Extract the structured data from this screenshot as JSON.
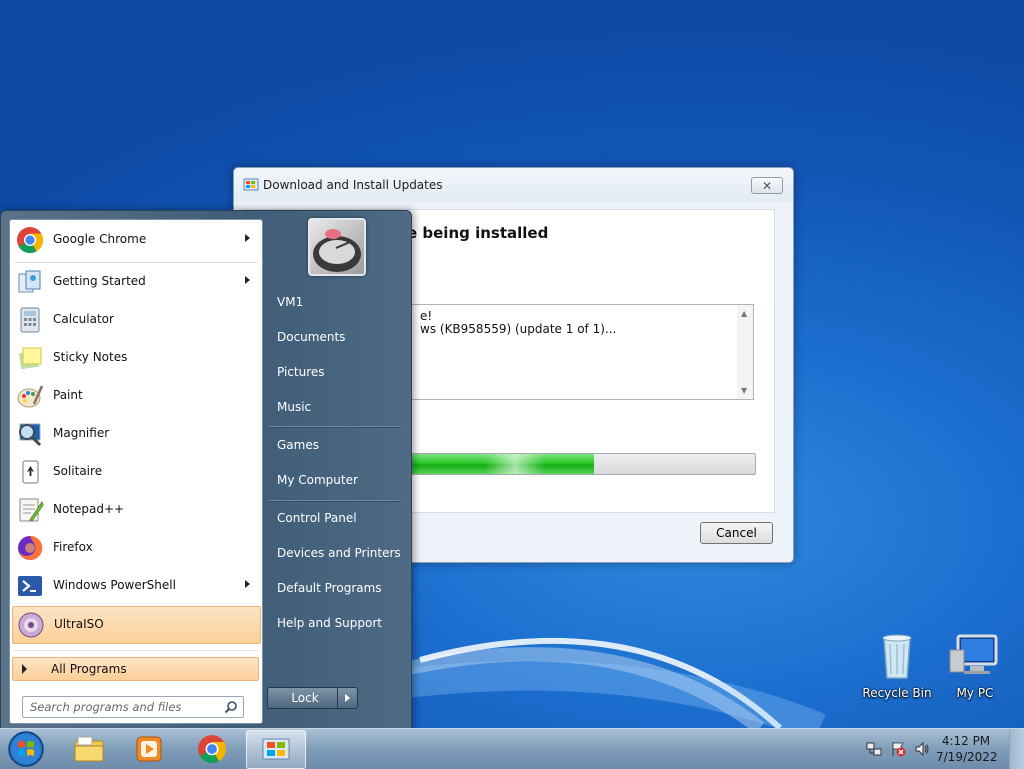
{
  "dialog": {
    "title": "Download and Install Updates",
    "heading": "e being installed",
    "log_line1": "e!",
    "log_line2": "ws (KB958559) (update 1 of 1)...",
    "progress": 0.53,
    "cancel_label": "Cancel"
  },
  "start_menu": {
    "pinned": [
      {
        "label": "Google Chrome",
        "icon": "chrome-icon",
        "has_submenu": true
      },
      {
        "label": "Getting Started",
        "icon": "getting-started-icon",
        "has_submenu": true
      },
      {
        "label": "Calculator",
        "icon": "calculator-icon",
        "has_submenu": false
      },
      {
        "label": "Sticky Notes",
        "icon": "sticky-notes-icon",
        "has_submenu": false
      },
      {
        "label": "Paint",
        "icon": "paint-icon",
        "has_submenu": false
      },
      {
        "label": "Magnifier",
        "icon": "magnifier-icon",
        "has_submenu": false
      },
      {
        "label": "Solitaire",
        "icon": "solitaire-icon",
        "has_submenu": false
      },
      {
        "label": "Notepad++",
        "icon": "notepadpp-icon",
        "has_submenu": false
      },
      {
        "label": "Firefox",
        "icon": "firefox-icon",
        "has_submenu": false
      },
      {
        "label": "Windows PowerShell",
        "icon": "powershell-icon",
        "has_submenu": true
      },
      {
        "label": "UltraISO",
        "icon": "ultraiso-icon",
        "has_submenu": false,
        "selected": true
      }
    ],
    "all_programs_label": "All Programs",
    "search_placeholder": "Search programs and files",
    "right_items": [
      "VM1",
      "Documents",
      "Pictures",
      "Music",
      "Games",
      "My Computer",
      "Control Panel",
      "Devices and Printers",
      "Default Programs",
      "Help and Support"
    ],
    "lock_label": "Lock"
  },
  "desktop_icons": [
    {
      "label": "Recycle Bin",
      "icon": "recycle-bin-icon"
    },
    {
      "label": "My PC",
      "icon": "my-pc-icon"
    }
  ],
  "taskbar": {
    "pinned": [
      "file-explorer-icon",
      "media-player-icon",
      "chrome-icon",
      "windows-update-icon"
    ],
    "active_index": 3,
    "clock_time": "4:12 PM",
    "clock_date": "7/19/2022"
  }
}
